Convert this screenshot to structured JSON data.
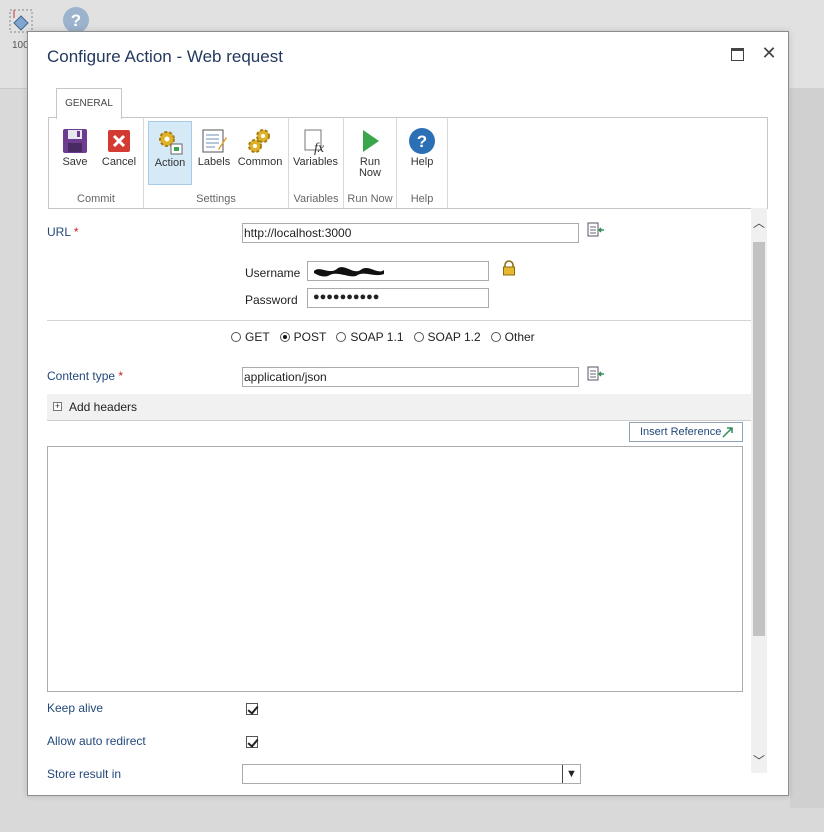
{
  "background": {
    "workflow_label": "100"
  },
  "dialog": {
    "title": "Configure Action - Web request"
  },
  "ribbon": {
    "tab": "GENERAL",
    "groups": [
      {
        "label": "Commit",
        "buttons": [
          "Save",
          "Cancel"
        ]
      },
      {
        "label": "Settings",
        "buttons": [
          "Action",
          "Labels",
          "Common"
        ]
      },
      {
        "label": "Variables",
        "buttons": [
          "Variables"
        ]
      },
      {
        "label": "Run Now",
        "buttons": [
          "Run Now"
        ]
      },
      {
        "label": "Help",
        "buttons": [
          "Help"
        ]
      }
    ],
    "run_now_line1": "Run",
    "run_now_line2": "Now"
  },
  "form": {
    "url_label": "URL",
    "required_marker": "*",
    "url_value": "http://localhost:3000",
    "username_label": "Username",
    "password_label": "Password",
    "password_value": "●●●●●●●●●●",
    "methods": [
      "GET",
      "POST",
      "SOAP 1.1",
      "SOAP 1.2",
      "Other"
    ],
    "selected_method": "POST",
    "content_type_label": "Content type",
    "content_type_value": "application/json",
    "add_headers_label": "Add headers",
    "insert_reference_label": "Insert Reference",
    "keep_alive_label": "Keep alive",
    "keep_alive_checked": true,
    "allow_redirect_label": "Allow auto redirect",
    "allow_redirect_checked": true,
    "store_result_label": "Store result in"
  },
  "colors": {
    "accent": "#23487a",
    "required": "#c41e1e",
    "active_button": "#d5e9f7"
  }
}
